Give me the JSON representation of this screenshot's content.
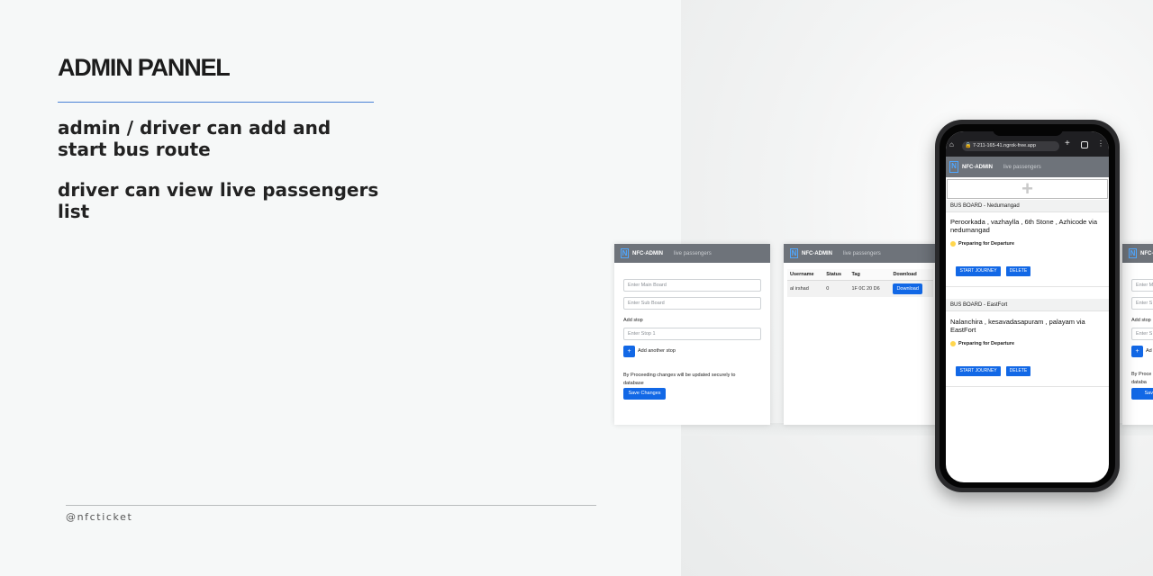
{
  "slide": {
    "title": "ADMIN PANNEL",
    "feature_1": "admin / driver can add and start bus route",
    "feature_2": "driver can view live passengers list",
    "handle": "@nfcticket"
  },
  "app": {
    "brand": "NFC-ADMIN",
    "nav_link": "live passengers",
    "logo_letter": "N"
  },
  "add_route_form": {
    "main_board_placeholder": "Enter Main Board",
    "sub_board_placeholder": "Enter Sub Board",
    "add_stop_label": "Add stop",
    "stop_placeholder": "Enter Stop 1",
    "add_another_stop_label": "Add another stop",
    "add_button_symbol": "+",
    "notice": "By Proceeding changes will be updated securely to database",
    "save_label": "Save Changes"
  },
  "passengers_table": {
    "columns": [
      "Username",
      "Status",
      "Tag",
      "Download"
    ],
    "rows": [
      {
        "username": "al irshad",
        "status": "0",
        "tag": "1F 0C 20 D6",
        "download_label": "Download"
      }
    ]
  },
  "phone": {
    "url": "7-211-165-41.ngrok-free.app",
    "add_symbol": "+",
    "boards": [
      {
        "header": "BUS BOARD - Nedumangad",
        "route": "Peroorkada , vazhaylla , 6th Stone , Azhicode via nedumangad",
        "status": "Preparing for Departure",
        "start_label": "START JOURNEY",
        "delete_label": "DELETE"
      },
      {
        "header": "BUS BOARD - EastFort",
        "route": "Nalanchira , kesavadasapuram , palayam via EastFort",
        "status": "Preparing for Departure",
        "start_label": "START JOURNEY",
        "delete_label": "DELETE"
      }
    ]
  },
  "partial_form": {
    "main_fragment": "Enter M",
    "sub_fragment": "Enter S",
    "add_stop_fragment": "Add stop",
    "stop_fragment": "Enter S",
    "add_fragment": "Ad",
    "notice_fragment_1": "By Proce",
    "notice_fragment_2": "databa",
    "save_fragment": "Save C"
  },
  "colors": {
    "accent_blue": "#1268e6",
    "nav_grey": "#6e737a",
    "status_yellow": "#ffd64d",
    "rule_blue": "#4a82d6"
  }
}
